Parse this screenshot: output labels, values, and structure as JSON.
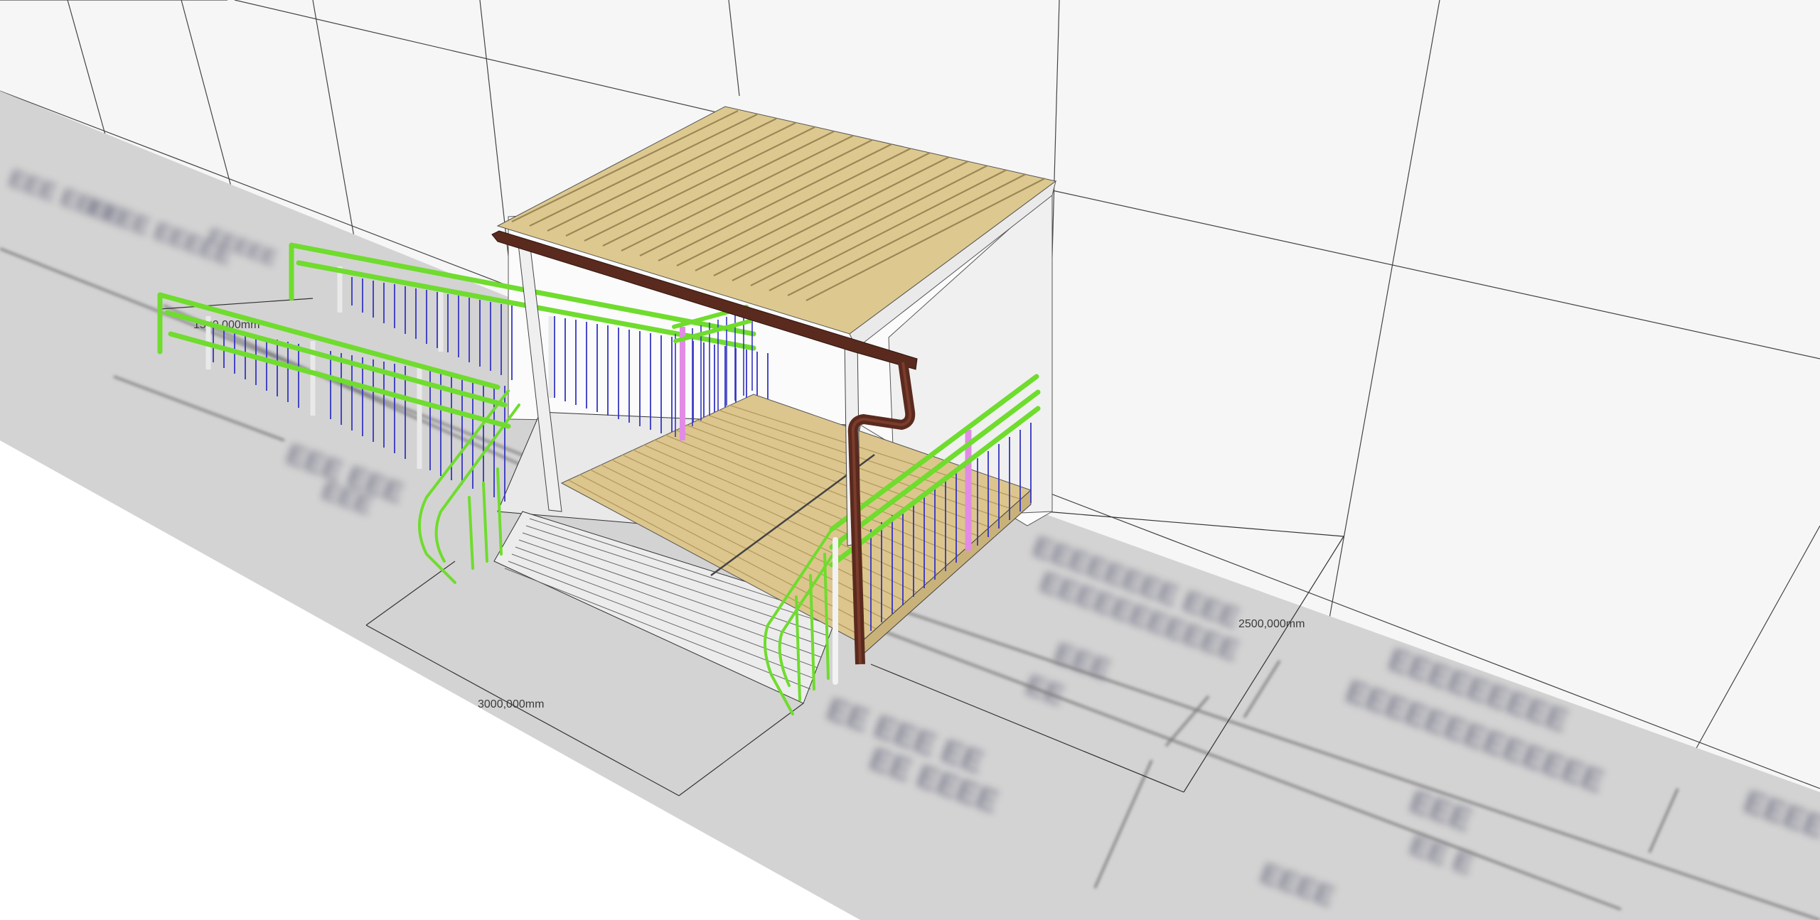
{
  "app": {
    "view": "3D model viewport"
  },
  "dimensions": {
    "width_label": "3000,000mm",
    "depth_label": "2500,000mm",
    "ramp_label": "1500,000mm"
  },
  "colors": {
    "sky": "#f5f5f5",
    "wall": "#f4f4f4",
    "ground": "#d2d2d2",
    "ground_light": "#ffffff",
    "roof": "#ddc98f",
    "roof_stripe": "#a89663",
    "deck": "#d9c48a",
    "gutter": "#5a2a1e",
    "railing_green": "#6fdc2e",
    "baluster_blue": "#3838c8",
    "post_pink": "#e28be6",
    "frame_white": "#f2f2f2",
    "line": "#333333"
  }
}
